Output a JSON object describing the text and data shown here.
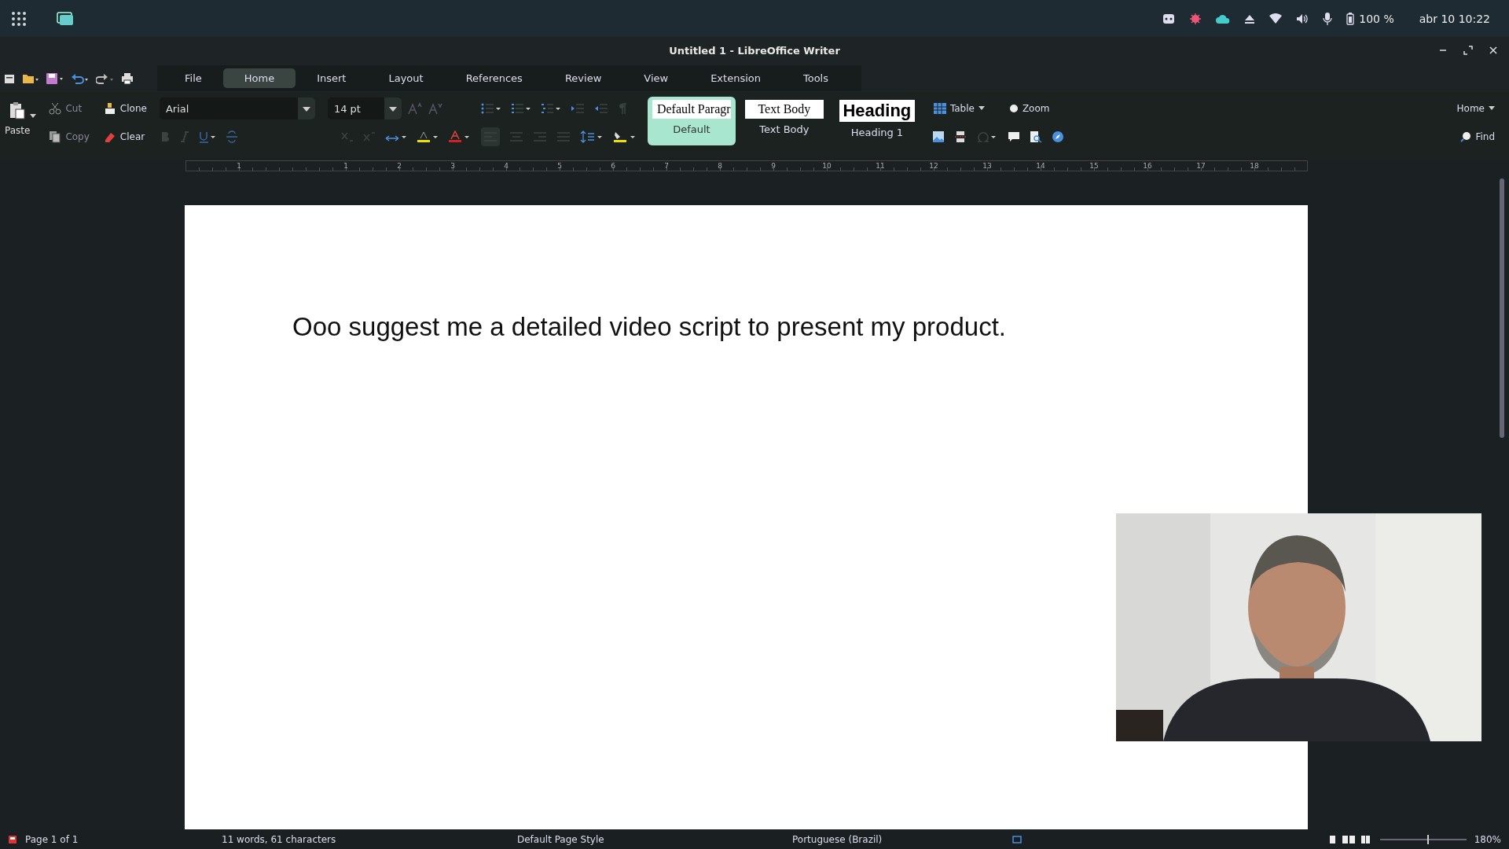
{
  "topbar": {
    "battery": "100 %",
    "clock": "abr 10 10:22"
  },
  "window": {
    "title": "Untitled 1 - LibreOffice Writer"
  },
  "tabs": [
    {
      "label": "File",
      "selected": false
    },
    {
      "label": "Home",
      "selected": true
    },
    {
      "label": "Insert",
      "selected": false
    },
    {
      "label": "Layout",
      "selected": false
    },
    {
      "label": "References",
      "selected": false
    },
    {
      "label": "Review",
      "selected": false
    },
    {
      "label": "View",
      "selected": false
    },
    {
      "label": "Extension",
      "selected": false
    },
    {
      "label": "Tools",
      "selected": false
    }
  ],
  "toolbar": {
    "paste": "Paste",
    "cut": "Cut",
    "copy": "Copy",
    "clone": "Clone",
    "clear": "Clear",
    "font": "Arial",
    "size": "14 pt",
    "styles": [
      {
        "kind": "default",
        "preview": "Default Paragr",
        "label": "Default",
        "selected": true
      },
      {
        "kind": "body",
        "preview": "Text Body",
        "label": "Text Body",
        "selected": false
      },
      {
        "kind": "heading",
        "preview": "Heading",
        "label": "Heading 1",
        "selected": false
      }
    ],
    "table": "Table",
    "zoom": "Zoom",
    "home": "Home",
    "find": "Find"
  },
  "ruler": [
    "1",
    "1",
    "2",
    "3",
    "4",
    "5",
    "6",
    "7",
    "8",
    "9",
    "10",
    "11",
    "12",
    "13",
    "14",
    "15",
    "16",
    "17",
    "18"
  ],
  "document": {
    "paragraphs": [
      "Ooo suggest me a detailed video script to present my product."
    ]
  },
  "status_bar": {
    "page": "Page 1 of 1",
    "count": "11 words, 61 characters",
    "style": "Default Page Style",
    "language": "Portuguese (Brazil)",
    "zoom_slider": {
      "level": 0.55
    },
    "zoom": "180%"
  }
}
